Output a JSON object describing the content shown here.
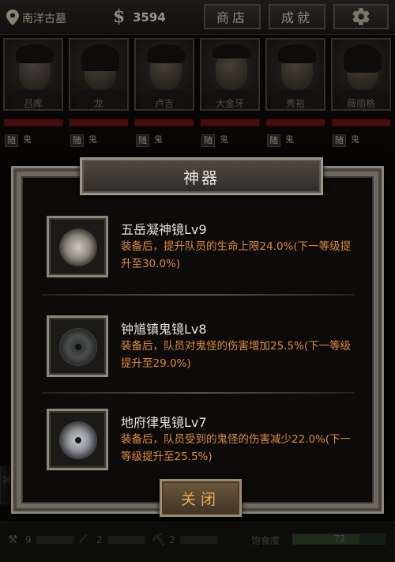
{
  "topbar": {
    "location": "南洋古墓",
    "money_symbol": "$",
    "money": "3594",
    "shop_label": "商店",
    "achievements_label": "成就"
  },
  "heroes": [
    {
      "name": "吕库",
      "tags": [
        "随",
        "鬼"
      ]
    },
    {
      "name": "龙",
      "tags": [
        "随",
        "鬼"
      ]
    },
    {
      "name": "卢吉",
      "tags": [
        "随",
        "鬼"
      ]
    },
    {
      "name": "大金牙",
      "tags": [
        "随",
        "鬼"
      ]
    },
    {
      "name": "秀裕",
      "tags": [
        "随",
        "鬼"
      ]
    },
    {
      "name": "薇丽格",
      "tags": [
        "随",
        "鬼"
      ]
    }
  ],
  "dialog": {
    "title": "神器",
    "artifacts": [
      {
        "name": "五岳凝神镜Lv9",
        "desc": "装备后，提升队员的生命上限24.0%(下一等级提升至30.0%)"
      },
      {
        "name": "钟馗镇鬼镜Lv8",
        "desc": "装备后，队员对鬼怪的伤害增加25.5%(下一等级提升至29.0%)"
      },
      {
        "name": "地府律鬼镜Lv7",
        "desc": "装备后，队员受到的鬼怪的伤害减少22.0%(下一等级提升至25.5%)"
      }
    ],
    "close_label": "关闭"
  },
  "bottombar": {
    "items": [
      {
        "value": "9"
      },
      {
        "value": "2"
      },
      {
        "value": "2"
      }
    ],
    "satiety_label": "饱食度",
    "satiety_value": "72",
    "satiety_fraction": 0.72,
    "side_tab_label": "神"
  },
  "colors": {
    "accent_text": "#e08a3a",
    "hp_bar": "#6e1414",
    "close_text": "#e8ac52"
  }
}
